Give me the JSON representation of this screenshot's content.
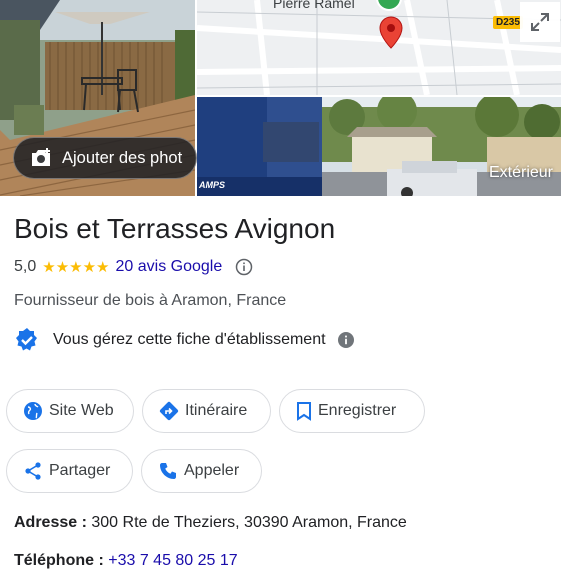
{
  "photos": {
    "add_photo_label": "Ajouter des phot",
    "map_place_label": "Pierre Ramel",
    "road_badge": "D235",
    "street_label": "Extérieur",
    "truck_text": "AMPS"
  },
  "business": {
    "name": "Bois et Terrasses Avignon",
    "rating": "5,0",
    "stars": "★★★★★",
    "reviews": "20 avis Google",
    "category": "Fournisseur de bois à Aramon, France",
    "managed_text": "Vous gérez cette fiche d'établissement"
  },
  "actions": {
    "website": "Site Web",
    "directions": "Itinéraire",
    "save": "Enregistrer",
    "share": "Partager",
    "call": "Appeler"
  },
  "details": {
    "address_label": "Adresse : ",
    "address": "300 Rte de Theziers, 30390 Aramon, France",
    "phone_label": "Téléphone : ",
    "phone": "+33 7 45 80 25 17"
  },
  "colors": {
    "link": "#1a0dab",
    "star": "#fbbc04",
    "icon_blue": "#1a73e8",
    "map_pin": "#ea4335"
  }
}
